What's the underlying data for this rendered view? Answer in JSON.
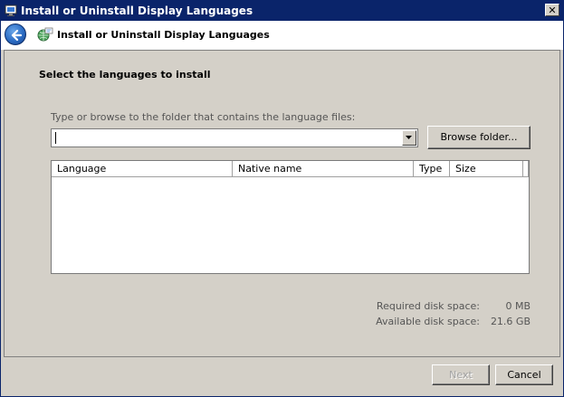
{
  "window": {
    "title": "Install or Uninstall Display Languages",
    "close_glyph": "✕"
  },
  "nav": {
    "title": "Install or Uninstall Display Languages",
    "back_icon": "back-arrow-icon",
    "wizard_icon": "language-globe-icon"
  },
  "main": {
    "heading": "Select the languages to install",
    "folder_label": "Type or browse to the folder that contains the language files:",
    "folder_value": "",
    "browse_label": "Browse folder...",
    "columns": [
      "Language",
      "Native name",
      "Type",
      "Size"
    ],
    "rows": []
  },
  "disk": {
    "required_label": "Required disk space:",
    "required_value": "0 MB",
    "available_label": "Available disk space:",
    "available_value": "21.6 GB"
  },
  "footer": {
    "next_label": "Next",
    "next_enabled": false,
    "cancel_label": "Cancel"
  },
  "colors": {
    "titlebar": "#0a246a",
    "face": "#d4d0c8",
    "back_button": "#2b6cc4"
  }
}
